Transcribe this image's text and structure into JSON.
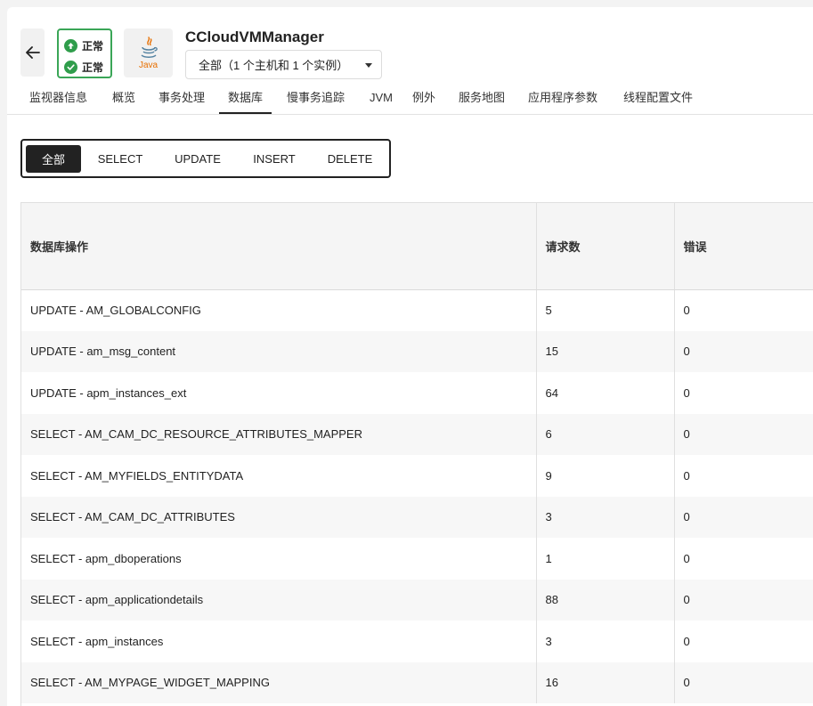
{
  "header": {
    "back_icon": "arrow-left-icon",
    "status": [
      {
        "icon": "arrow-up-circle-icon",
        "label": "正常",
        "color": "#2f9d4b"
      },
      {
        "icon": "check-circle-icon",
        "label": "正常",
        "color": "#2f9d4b"
      }
    ],
    "logo": {
      "icon": "java-logo-icon",
      "label": "Java"
    },
    "title": "CCloudVMManager",
    "scope_select": {
      "value": "全部（1 个主机和 1 个实例）"
    }
  },
  "tabs": [
    {
      "label": "监视器信息"
    },
    {
      "label": "概览"
    },
    {
      "label": "事务处理"
    },
    {
      "label": "数据库"
    },
    {
      "label": "慢事务追踪"
    },
    {
      "label": "JVM"
    },
    {
      "label": "例外"
    },
    {
      "label": "服务地图"
    },
    {
      "label": "应用程序参数"
    },
    {
      "label": "线程配置文件"
    }
  ],
  "active_tab": "数据库",
  "filters": [
    {
      "label": "全部"
    },
    {
      "label": "SELECT"
    },
    {
      "label": "UPDATE"
    },
    {
      "label": "INSERT"
    },
    {
      "label": "DELETE"
    }
  ],
  "active_filter": "全部",
  "table": {
    "columns": [
      "数据库操作",
      "请求数",
      "错误"
    ],
    "rows": [
      [
        "UPDATE - AM_GLOBALCONFIG",
        "5",
        "0"
      ],
      [
        "UPDATE - am_msg_content",
        "15",
        "0"
      ],
      [
        "UPDATE - apm_instances_ext",
        "64",
        "0"
      ],
      [
        "SELECT - AM_CAM_DC_RESOURCE_ATTRIBUTES_MAPPER",
        "6",
        "0"
      ],
      [
        "SELECT - AM_MYFIELDS_ENTITYDATA",
        "9",
        "0"
      ],
      [
        "SELECT - AM_CAM_DC_ATTRIBUTES",
        "3",
        "0"
      ],
      [
        "SELECT - apm_dboperations",
        "1",
        "0"
      ],
      [
        "SELECT - apm_applicationdetails",
        "88",
        "0"
      ],
      [
        "SELECT - apm_instances",
        "3",
        "0"
      ],
      [
        "SELECT - AM_MYPAGE_WIDGET_MAPPING",
        "16",
        "0"
      ]
    ]
  }
}
